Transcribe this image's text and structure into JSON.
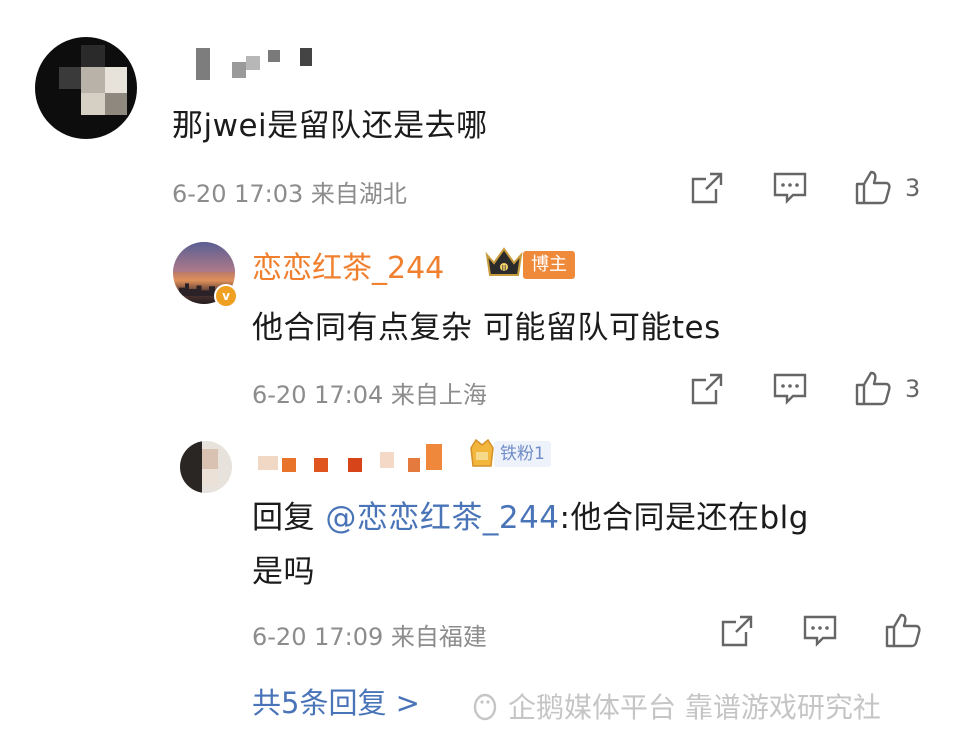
{
  "comments": [
    {
      "text": "那jwei是留队还是去哪",
      "time": "6-20 17:03",
      "location": "来自湖北",
      "likes": "3"
    },
    {
      "username": "恋恋红茶_244",
      "badge": "博主",
      "text": "他合同有点复杂 可能留队可能tes",
      "time": "6-20 17:04",
      "location": "来自上海",
      "likes": "3"
    },
    {
      "fan_badge": "铁粉1",
      "reply_prefix": "回复 ",
      "mention": "@恋恋红茶_244",
      "text_line1": ":他合同是还在blg",
      "text_line2": "是吗",
      "time": "6-20 17:09",
      "location": "来自福建"
    }
  ],
  "more_replies": "共5条回复 >",
  "watermark": "企鹅媒体平台 靠谱游戏研究社",
  "icons": [
    "share-icon",
    "comment-icon",
    "like-icon",
    "crown-icon",
    "fan-badge-icon",
    "verified-badge-icon"
  ],
  "colors": {
    "accent_orange": "#f07f2e",
    "link_blue": "#4a74b8",
    "meta_gray": "#8c8c8c"
  }
}
